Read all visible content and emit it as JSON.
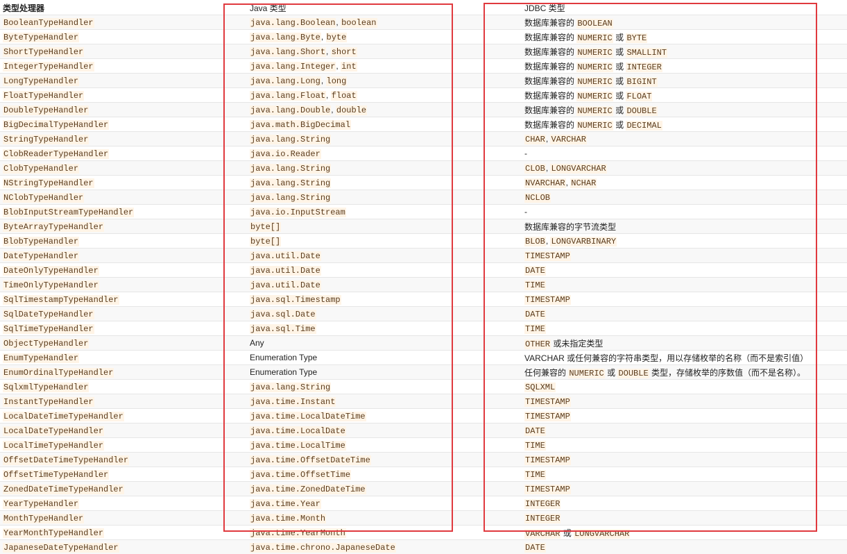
{
  "headers": [
    "类型处理器",
    "Java 类型",
    "JDBC 类型"
  ],
  "rows": [
    {
      "handler": "BooleanTypeHandler",
      "java": [
        {
          "t": "java.lang.Boolean",
          "c": true
        },
        {
          "t": ", ",
          "c": false
        },
        {
          "t": "boolean",
          "c": true
        }
      ],
      "jdbc": [
        {
          "t": "数据库兼容的 ",
          "c": false
        },
        {
          "t": "BOOLEAN",
          "c": true
        }
      ]
    },
    {
      "handler": "ByteTypeHandler",
      "java": [
        {
          "t": "java.lang.Byte",
          "c": true
        },
        {
          "t": ", ",
          "c": false
        },
        {
          "t": "byte",
          "c": true
        }
      ],
      "jdbc": [
        {
          "t": "数据库兼容的 ",
          "c": false
        },
        {
          "t": "NUMERIC",
          "c": true
        },
        {
          "t": " 或 ",
          "c": false
        },
        {
          "t": "BYTE",
          "c": true
        }
      ]
    },
    {
      "handler": "ShortTypeHandler",
      "java": [
        {
          "t": "java.lang.Short",
          "c": true
        },
        {
          "t": ", ",
          "c": false
        },
        {
          "t": "short",
          "c": true
        }
      ],
      "jdbc": [
        {
          "t": "数据库兼容的 ",
          "c": false
        },
        {
          "t": "NUMERIC",
          "c": true
        },
        {
          "t": " 或 ",
          "c": false
        },
        {
          "t": "SMALLINT",
          "c": true
        }
      ]
    },
    {
      "handler": "IntegerTypeHandler",
      "java": [
        {
          "t": "java.lang.Integer",
          "c": true
        },
        {
          "t": ", ",
          "c": false
        },
        {
          "t": "int",
          "c": true
        }
      ],
      "jdbc": [
        {
          "t": "数据库兼容的 ",
          "c": false
        },
        {
          "t": "NUMERIC",
          "c": true
        },
        {
          "t": " 或 ",
          "c": false
        },
        {
          "t": "INTEGER",
          "c": true
        }
      ]
    },
    {
      "handler": "LongTypeHandler",
      "java": [
        {
          "t": "java.lang.Long",
          "c": true
        },
        {
          "t": ", ",
          "c": false
        },
        {
          "t": "long",
          "c": true
        }
      ],
      "jdbc": [
        {
          "t": "数据库兼容的 ",
          "c": false
        },
        {
          "t": "NUMERIC",
          "c": true
        },
        {
          "t": " 或 ",
          "c": false
        },
        {
          "t": "BIGINT",
          "c": true
        }
      ]
    },
    {
      "handler": "FloatTypeHandler",
      "java": [
        {
          "t": "java.lang.Float",
          "c": true
        },
        {
          "t": ", ",
          "c": false
        },
        {
          "t": "float",
          "c": true
        }
      ],
      "jdbc": [
        {
          "t": "数据库兼容的 ",
          "c": false
        },
        {
          "t": "NUMERIC",
          "c": true
        },
        {
          "t": " 或 ",
          "c": false
        },
        {
          "t": "FLOAT",
          "c": true
        }
      ]
    },
    {
      "handler": "DoubleTypeHandler",
      "java": [
        {
          "t": "java.lang.Double",
          "c": true
        },
        {
          "t": ", ",
          "c": false
        },
        {
          "t": "double",
          "c": true
        }
      ],
      "jdbc": [
        {
          "t": "数据库兼容的 ",
          "c": false
        },
        {
          "t": "NUMERIC",
          "c": true
        },
        {
          "t": " 或 ",
          "c": false
        },
        {
          "t": "DOUBLE",
          "c": true
        }
      ]
    },
    {
      "handler": "BigDecimalTypeHandler",
      "java": [
        {
          "t": "java.math.BigDecimal",
          "c": true
        }
      ],
      "jdbc": [
        {
          "t": "数据库兼容的 ",
          "c": false
        },
        {
          "t": "NUMERIC",
          "c": true
        },
        {
          "t": " 或 ",
          "c": false
        },
        {
          "t": "DECIMAL",
          "c": true
        }
      ]
    },
    {
      "handler": "StringTypeHandler",
      "java": [
        {
          "t": "java.lang.String",
          "c": true
        }
      ],
      "jdbc": [
        {
          "t": "CHAR",
          "c": true
        },
        {
          "t": ", ",
          "c": false
        },
        {
          "t": "VARCHAR",
          "c": true
        }
      ]
    },
    {
      "handler": "ClobReaderTypeHandler",
      "java": [
        {
          "t": "java.io.Reader",
          "c": true
        }
      ],
      "jdbc": [
        {
          "t": "-",
          "c": false
        }
      ]
    },
    {
      "handler": "ClobTypeHandler",
      "java": [
        {
          "t": "java.lang.String",
          "c": true
        }
      ],
      "jdbc": [
        {
          "t": "CLOB",
          "c": true
        },
        {
          "t": ", ",
          "c": false
        },
        {
          "t": "LONGVARCHAR",
          "c": true
        }
      ]
    },
    {
      "handler": "NStringTypeHandler",
      "java": [
        {
          "t": "java.lang.String",
          "c": true
        }
      ],
      "jdbc": [
        {
          "t": "NVARCHAR",
          "c": true
        },
        {
          "t": ", ",
          "c": false
        },
        {
          "t": "NCHAR",
          "c": true
        }
      ]
    },
    {
      "handler": "NClobTypeHandler",
      "java": [
        {
          "t": "java.lang.String",
          "c": true
        }
      ],
      "jdbc": [
        {
          "t": "NCLOB",
          "c": true
        }
      ]
    },
    {
      "handler": "BlobInputStreamTypeHandler",
      "java": [
        {
          "t": "java.io.InputStream",
          "c": true
        }
      ],
      "jdbc": [
        {
          "t": "-",
          "c": false
        }
      ]
    },
    {
      "handler": "ByteArrayTypeHandler",
      "java": [
        {
          "t": "byte[]",
          "c": true
        }
      ],
      "jdbc": [
        {
          "t": "数据库兼容的字节流类型",
          "c": false
        }
      ]
    },
    {
      "handler": "BlobTypeHandler",
      "java": [
        {
          "t": "byte[]",
          "c": true
        }
      ],
      "jdbc": [
        {
          "t": "BLOB",
          "c": true
        },
        {
          "t": ", ",
          "c": false
        },
        {
          "t": "LONGVARBINARY",
          "c": true
        }
      ]
    },
    {
      "handler": "DateTypeHandler",
      "java": [
        {
          "t": "java.util.Date",
          "c": true
        }
      ],
      "jdbc": [
        {
          "t": "TIMESTAMP",
          "c": true
        }
      ]
    },
    {
      "handler": "DateOnlyTypeHandler",
      "java": [
        {
          "t": "java.util.Date",
          "c": true
        }
      ],
      "jdbc": [
        {
          "t": "DATE",
          "c": true
        }
      ]
    },
    {
      "handler": "TimeOnlyTypeHandler",
      "java": [
        {
          "t": "java.util.Date",
          "c": true
        }
      ],
      "jdbc": [
        {
          "t": "TIME",
          "c": true
        }
      ]
    },
    {
      "handler": "SqlTimestampTypeHandler",
      "java": [
        {
          "t": "java.sql.Timestamp",
          "c": true
        }
      ],
      "jdbc": [
        {
          "t": "TIMESTAMP",
          "c": true
        }
      ]
    },
    {
      "handler": "SqlDateTypeHandler",
      "java": [
        {
          "t": "java.sql.Date",
          "c": true
        }
      ],
      "jdbc": [
        {
          "t": "DATE",
          "c": true
        }
      ]
    },
    {
      "handler": "SqlTimeTypeHandler",
      "java": [
        {
          "t": "java.sql.Time",
          "c": true
        }
      ],
      "jdbc": [
        {
          "t": "TIME",
          "c": true
        }
      ]
    },
    {
      "handler": "ObjectTypeHandler",
      "java": [
        {
          "t": "Any",
          "c": false
        }
      ],
      "jdbc": [
        {
          "t": "OTHER",
          "c": true
        },
        {
          "t": " 或未指定类型",
          "c": false
        }
      ]
    },
    {
      "handler": "EnumTypeHandler",
      "java": [
        {
          "t": "Enumeration Type",
          "c": false
        }
      ],
      "jdbc": [
        {
          "t": "VARCHAR 或任何兼容的字符串类型，用以存储枚举的名称（而不是索引值）",
          "c": false
        }
      ]
    },
    {
      "handler": "EnumOrdinalTypeHandler",
      "java": [
        {
          "t": "Enumeration Type",
          "c": false
        }
      ],
      "jdbc": [
        {
          "t": "任何兼容的 ",
          "c": false
        },
        {
          "t": "NUMERIC",
          "c": true
        },
        {
          "t": " 或 ",
          "c": false
        },
        {
          "t": "DOUBLE",
          "c": true
        },
        {
          "t": " 类型，存储枚举的序数值（而不是名称）。",
          "c": false
        }
      ]
    },
    {
      "handler": "SqlxmlTypeHandler",
      "java": [
        {
          "t": "java.lang.String",
          "c": true
        }
      ],
      "jdbc": [
        {
          "t": "SQLXML",
          "c": true
        }
      ]
    },
    {
      "handler": "InstantTypeHandler",
      "java": [
        {
          "t": "java.time.Instant",
          "c": true
        }
      ],
      "jdbc": [
        {
          "t": "TIMESTAMP",
          "c": true
        }
      ]
    },
    {
      "handler": "LocalDateTimeTypeHandler",
      "java": [
        {
          "t": "java.time.LocalDateTime",
          "c": true
        }
      ],
      "jdbc": [
        {
          "t": "TIMESTAMP",
          "c": true
        }
      ]
    },
    {
      "handler": "LocalDateTypeHandler",
      "java": [
        {
          "t": "java.time.LocalDate",
          "c": true
        }
      ],
      "jdbc": [
        {
          "t": "DATE",
          "c": true
        }
      ]
    },
    {
      "handler": "LocalTimeTypeHandler",
      "java": [
        {
          "t": "java.time.LocalTime",
          "c": true
        }
      ],
      "jdbc": [
        {
          "t": "TIME",
          "c": true
        }
      ]
    },
    {
      "handler": "OffsetDateTimeTypeHandler",
      "java": [
        {
          "t": "java.time.OffsetDateTime",
          "c": true
        }
      ],
      "jdbc": [
        {
          "t": "TIMESTAMP",
          "c": true
        }
      ]
    },
    {
      "handler": "OffsetTimeTypeHandler",
      "java": [
        {
          "t": "java.time.OffsetTime",
          "c": true
        }
      ],
      "jdbc": [
        {
          "t": "TIME",
          "c": true
        }
      ]
    },
    {
      "handler": "ZonedDateTimeTypeHandler",
      "java": [
        {
          "t": "java.time.ZonedDateTime",
          "c": true
        }
      ],
      "jdbc": [
        {
          "t": "TIMESTAMP",
          "c": true
        }
      ]
    },
    {
      "handler": "YearTypeHandler",
      "java": [
        {
          "t": "java.time.Year",
          "c": true
        }
      ],
      "jdbc": [
        {
          "t": "INTEGER",
          "c": true
        }
      ]
    },
    {
      "handler": "MonthTypeHandler",
      "java": [
        {
          "t": "java.time.Month",
          "c": true
        }
      ],
      "jdbc": [
        {
          "t": "INTEGER",
          "c": true
        }
      ]
    },
    {
      "handler": "YearMonthTypeHandler",
      "java": [
        {
          "t": "java.time.YearMonth",
          "c": true
        }
      ],
      "jdbc": [
        {
          "t": "VARCHAR",
          "c": true
        },
        {
          "t": " 或 ",
          "c": false
        },
        {
          "t": "LONGVARCHAR",
          "c": true
        }
      ]
    },
    {
      "handler": "JapaneseDateTypeHandler",
      "java": [
        {
          "t": "java.time.chrono.JapaneseDate",
          "c": true
        }
      ],
      "jdbc": [
        {
          "t": "DATE",
          "c": true
        }
      ]
    }
  ],
  "highlight_color": "#e0393e",
  "code_background": "#fff4e6"
}
